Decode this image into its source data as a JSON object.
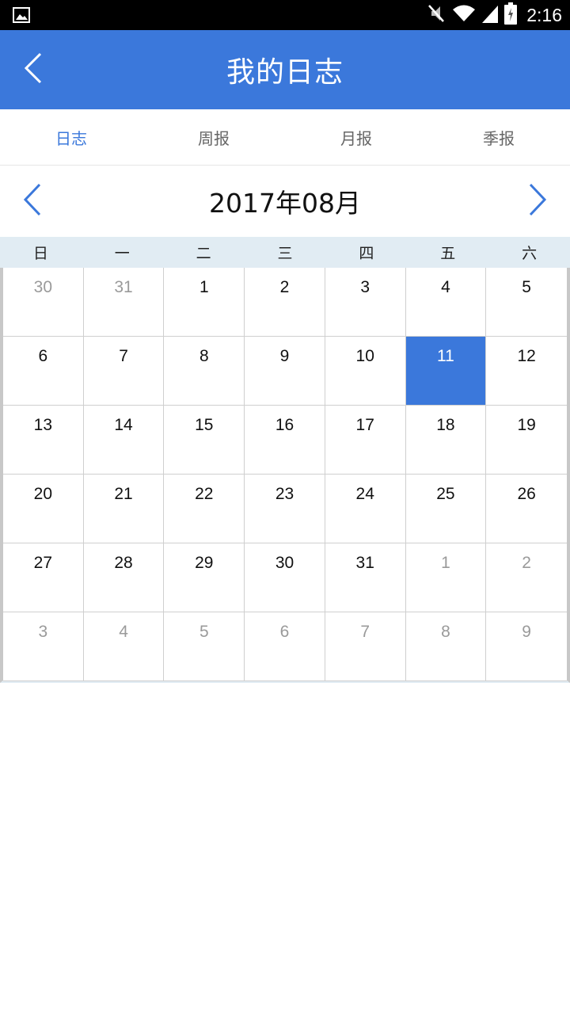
{
  "status_bar": {
    "time": "2:16",
    "icons": [
      "gallery-icon",
      "mute-icon",
      "wifi-icon",
      "signal-icon",
      "battery-icon"
    ]
  },
  "header": {
    "title": "我的日志",
    "back_icon": "chevron-left-icon"
  },
  "tabs": [
    {
      "label": "日志",
      "active": true
    },
    {
      "label": "周报",
      "active": false
    },
    {
      "label": "月报",
      "active": false
    },
    {
      "label": "季报",
      "active": false
    }
  ],
  "month_nav": {
    "label": "2017年08月",
    "prev_icon": "chevron-left-icon",
    "next_icon": "chevron-right-icon"
  },
  "weekdays": [
    "日",
    "一",
    "二",
    "三",
    "四",
    "五",
    "六"
  ],
  "calendar": {
    "selected_day": "11",
    "days": [
      {
        "d": "30",
        "muted": true
      },
      {
        "d": "31",
        "muted": true
      },
      {
        "d": "1"
      },
      {
        "d": "2"
      },
      {
        "d": "3"
      },
      {
        "d": "4"
      },
      {
        "d": "5"
      },
      {
        "d": "6"
      },
      {
        "d": "7"
      },
      {
        "d": "8"
      },
      {
        "d": "9"
      },
      {
        "d": "10"
      },
      {
        "d": "11",
        "selected": true
      },
      {
        "d": "12"
      },
      {
        "d": "13"
      },
      {
        "d": "14"
      },
      {
        "d": "15"
      },
      {
        "d": "16"
      },
      {
        "d": "17"
      },
      {
        "d": "18"
      },
      {
        "d": "19"
      },
      {
        "d": "20"
      },
      {
        "d": "21"
      },
      {
        "d": "22"
      },
      {
        "d": "23"
      },
      {
        "d": "24"
      },
      {
        "d": "25"
      },
      {
        "d": "26"
      },
      {
        "d": "27"
      },
      {
        "d": "28"
      },
      {
        "d": "29"
      },
      {
        "d": "30"
      },
      {
        "d": "31"
      },
      {
        "d": "1",
        "muted": true
      },
      {
        "d": "2",
        "muted": true
      },
      {
        "d": "3",
        "muted": true
      },
      {
        "d": "4",
        "muted": true
      },
      {
        "d": "5",
        "muted": true
      },
      {
        "d": "6",
        "muted": true
      },
      {
        "d": "7",
        "muted": true
      },
      {
        "d": "8",
        "muted": true
      },
      {
        "d": "9",
        "muted": true
      }
    ]
  },
  "colors": {
    "accent": "#3b78db",
    "weekday_bar": "#e1ecf3",
    "muted_text": "#9a9a9a"
  }
}
